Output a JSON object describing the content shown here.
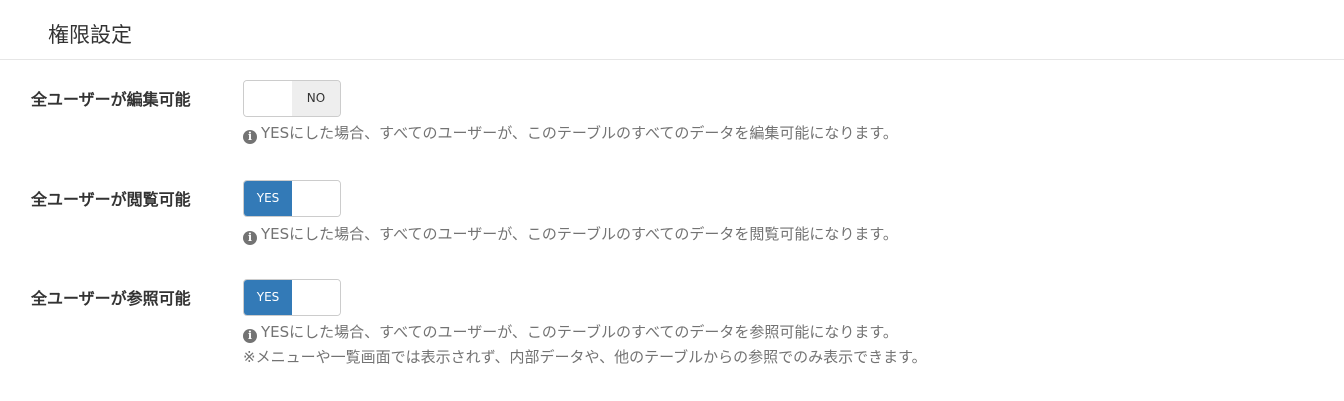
{
  "panel": {
    "title": "権限設定"
  },
  "settings": [
    {
      "label": "全ユーザーが編集可能",
      "toggle": {
        "state": "NO",
        "label": "NO"
      },
      "help": [
        "YESにした場合、すべてのユーザーが、このテーブルのすべてのデータを編集可能になります。"
      ]
    },
    {
      "label": "全ユーザーが閲覧可能",
      "toggle": {
        "state": "YES",
        "label": "YES"
      },
      "help": [
        "YESにした場合、すべてのユーザーが、このテーブルのすべてのデータを閲覧可能になります。"
      ]
    },
    {
      "label": "全ユーザーが参照可能",
      "toggle": {
        "state": "YES",
        "label": "YES"
      },
      "help": [
        "YESにした場合、すべてのユーザーが、このテーブルのすべてのデータを参照可能になります。",
        "※メニューや一覧画面では表示されず、内部データや、他のテーブルからの参照でのみ表示できます。"
      ]
    }
  ],
  "icons": {
    "info": "info-circle-icon",
    "info_glyph": "i"
  },
  "colors": {
    "accent": "#337ab7",
    "off_background": "#eeeeee",
    "help_text": "#737373",
    "label_text": "#333333"
  }
}
